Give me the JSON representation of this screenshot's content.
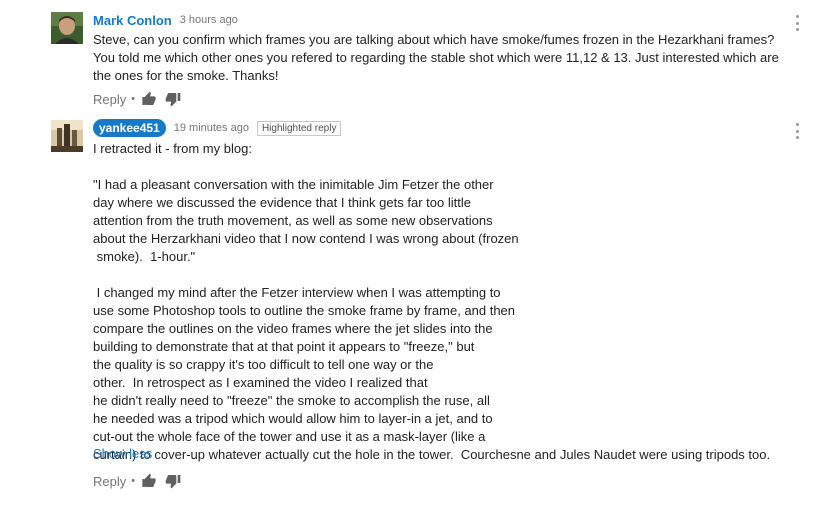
{
  "comments": [
    {
      "author": "Mark Conlon",
      "time": "3 hours ago",
      "text": "Steve, can you confirm which frames you are talking about which have smoke/fumes frozen in the Hezarkhani frames?\nYou told me which other ones you refered to regarding the stable shot which were 11,12 & 13. Just interested which are\nthe ones for the smoke. Thanks!",
      "reply_label": "Reply",
      "separator": "•"
    },
    {
      "author": "yankee451",
      "time": "19 minutes ago",
      "badge": "Highlighted reply",
      "text": "I retracted it - from my blog:\n\n\"I had a pleasant conversation with the inimitable Jim Fetzer the other\nday where we discussed the evidence that I think gets far too little\nattention from the truth movement, as well as some new observations\nabout the Herzarkhani video that I now contend I was wrong about (frozen\n smoke).  1-hour.\"\n\n I changed my mind after the Fetzer interview when I was attempting to\nuse some Photoshop tools to outline the smoke frame by frame, and then\ncompare the outlines on the video frames where the jet slides into the\nbuilding to demonstrate that at that point it appears to \"freeze,\" but\nthe quality is so crappy it's too difficult to tell one way or the\nother.  In retrospect as I examined the video I realized that\nhe didn't really need to \"freeze\" the smoke to accomplish the ruse, all\nhe needed was a tripod which would allow him to layer-in a jet, and to\ncut-out the whole face of the tower and use it as a mask-layer (like a\ncurtain) to cover-up whatever actually cut the hole in the tower.  Courchesne and Jules Naudet were using tripods too.",
      "show_less_label": "Show less",
      "reply_label": "Reply",
      "separator": "•"
    }
  ],
  "colors": {
    "link": "#167ac6",
    "muted": "#767676",
    "icon": "#606060",
    "text": "#222222"
  },
  "icons": [
    "more-vert-icon",
    "thumb-up-icon",
    "thumb-down-icon"
  ]
}
